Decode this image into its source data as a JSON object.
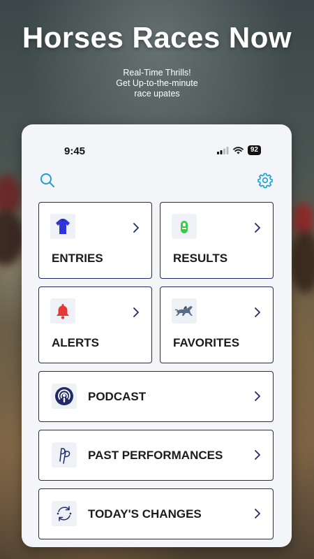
{
  "hero": {
    "title": "Horses Races Now",
    "subtitle_lines": [
      "Real-Time Thrills!",
      "Get Up-to-the-minute",
      "race upates"
    ]
  },
  "status_bar": {
    "time": "9:45",
    "battery": "92",
    "icons": [
      "signal-icon",
      "wifi-icon",
      "battery-icon"
    ]
  },
  "toolbar": {
    "left_icon": "search-icon",
    "right_icon": "gear-icon"
  },
  "tiles": [
    {
      "label": "ENTRIES",
      "icon": "jockey-silks-icon"
    },
    {
      "label": "RESULTS",
      "icon": "results-icon"
    },
    {
      "label": "ALERTS",
      "icon": "bell-icon"
    },
    {
      "label": "FAVORITES",
      "icon": "racehorse-icon"
    }
  ],
  "rows": [
    {
      "label": "PODCAST",
      "icon": "podcast-icon"
    },
    {
      "label": "PAST PERFORMANCES",
      "icon": "pp-icon"
    },
    {
      "label": "TODAY'S CHANGES",
      "icon": "changes-icon"
    }
  ],
  "colors": {
    "accent": "#1a9fd8",
    "card_border": "#1f2a66",
    "entries_icon": "#2f35d8",
    "results_icon": "#3ec84a",
    "alerts_icon": "#e53935",
    "navy_icon": "#1f2a66"
  }
}
